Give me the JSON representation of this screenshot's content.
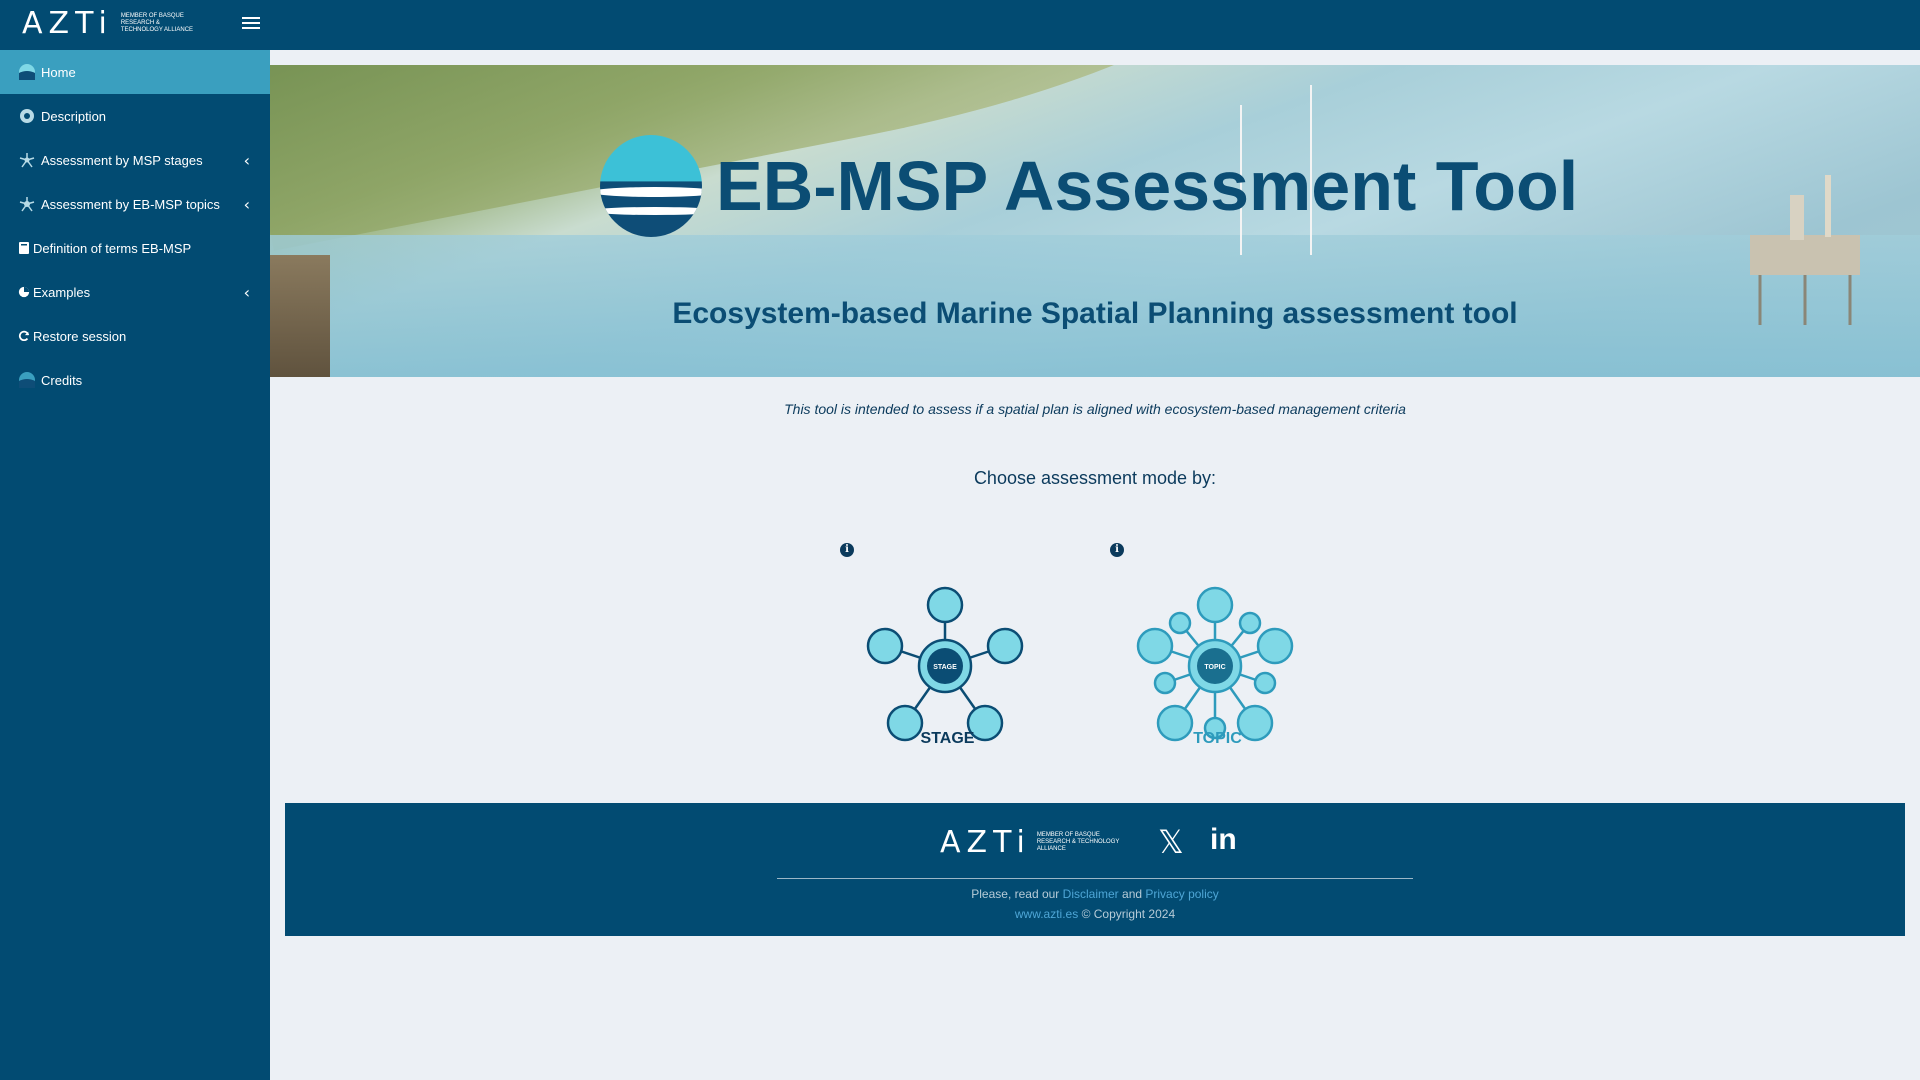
{
  "header": {
    "logo_text": "AZTi",
    "logo_tagline": "MEMBER OF BASQUE RESEARCH & TECHNOLOGY ALLIANCE",
    "menu_icon": "hamburger-icon"
  },
  "sidebar": {
    "items": [
      {
        "label": "Home",
        "icon": "globe-icon",
        "active": true
      },
      {
        "label": "Description",
        "icon": "gear-icon"
      },
      {
        "label": "Assessment by MSP stages",
        "icon": "network-icon",
        "chevron": "‹"
      },
      {
        "label": "Assessment by EB-MSP topics",
        "icon": "network-icon",
        "chevron": "‹"
      },
      {
        "label": "Definition of terms EB-MSP",
        "icon": "book-icon"
      },
      {
        "label": "Examples",
        "icon": "pie-chart-icon",
        "chevron": "‹"
      },
      {
        "label": "Restore session",
        "icon": "refresh-icon"
      },
      {
        "label": "Credits",
        "icon": "globe-icon"
      }
    ]
  },
  "banner": {
    "title": "EB-MSP Assessment Tool",
    "subtitle": "Ecosystem-based Marine Spatial Planning assessment tool"
  },
  "main": {
    "intro": "This tool is intended to assess if a spatial plan is aligned with ecosystem-based management criteria",
    "choose_label": "Choose assessment mode by:",
    "modes": [
      {
        "label": "STAGE",
        "badge": "STAGE",
        "info_icon": "info-icon"
      },
      {
        "label": "TOPIC",
        "badge": "TOPIC",
        "info_icon": "info-icon"
      }
    ]
  },
  "footer": {
    "logo_text": "AZTi",
    "logo_tagline": "MEMBER OF BASQUE RESEARCH & TECHNOLOGY ALLIANCE",
    "social": [
      "x-icon",
      "linkedin-icon"
    ],
    "read_prefix": "Please, read our",
    "disclaimer": "Disclaimer",
    "and": "and",
    "privacy": "Privacy policy",
    "site": "www.azti.es",
    "copyright": "© Copyright 2024"
  },
  "colors": {
    "primary": "#024b72",
    "active": "#3a9fbf",
    "background": "#ecf0f5",
    "title": "#0b4d74",
    "accent_cyan": "#7fd8e6"
  }
}
